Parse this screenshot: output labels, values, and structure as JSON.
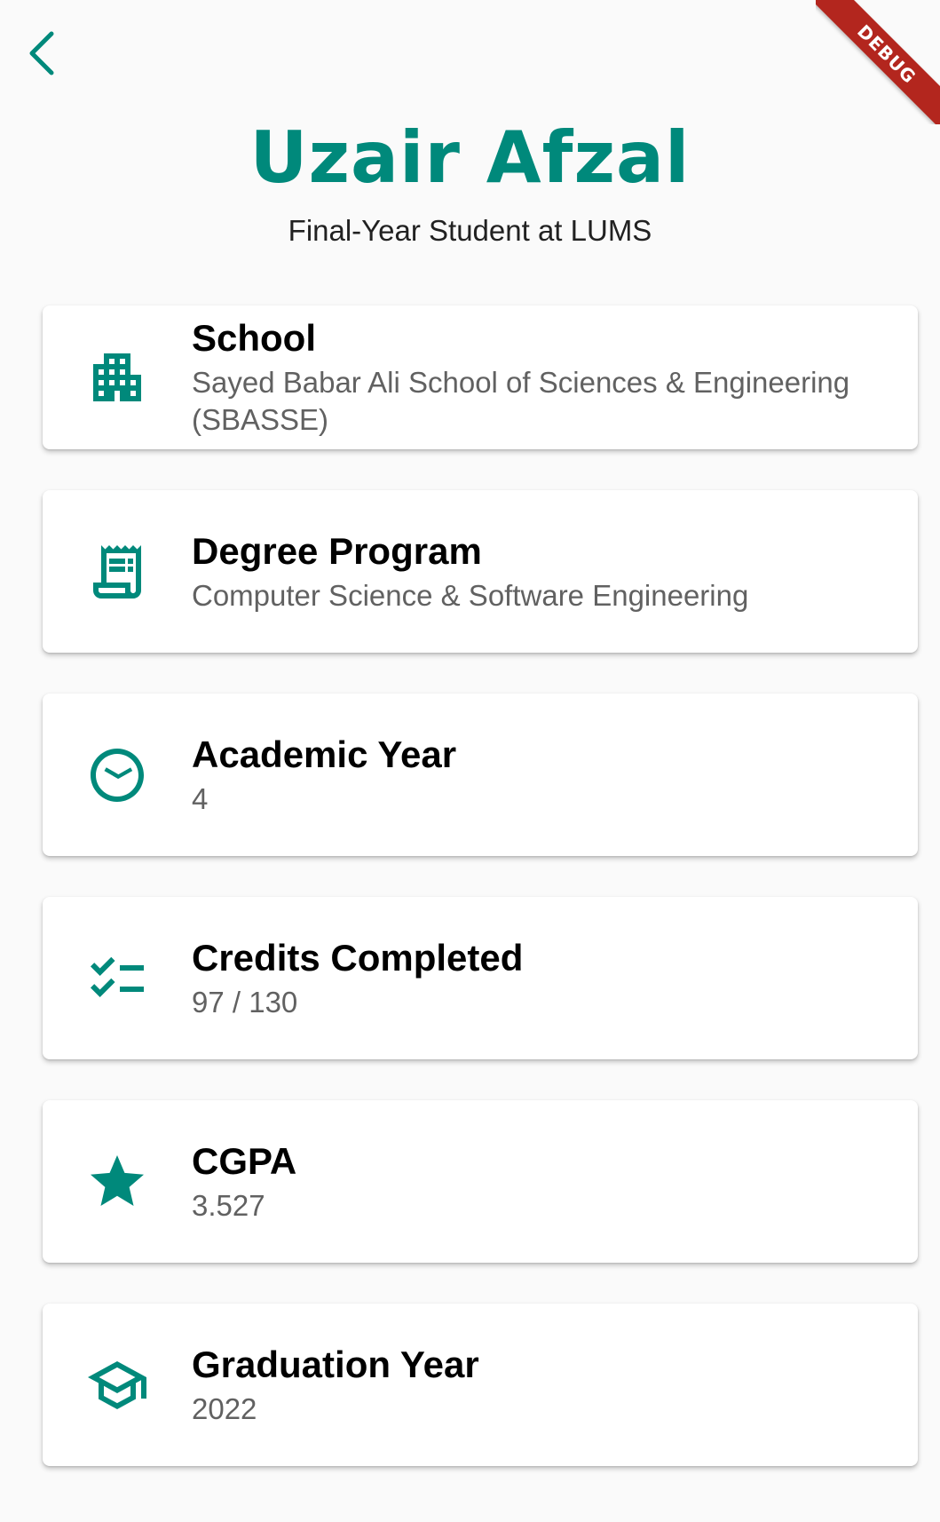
{
  "appbar": {
    "back_icon": "arrow-back-ios-icon",
    "accent_color": "#00897b"
  },
  "debug_banner": {
    "label": "DEBUG",
    "color": "#b3261e"
  },
  "profile": {
    "name": "Uzair Afzal",
    "subtitle": "Final-Year Student at LUMS"
  },
  "cards": [
    {
      "icon": "apartment-icon",
      "title": "School",
      "value": "Sayed Babar Ali School of Sciences & Engineering (SBASSE)"
    },
    {
      "icon": "receipt-long-icon",
      "title": "Degree Program",
      "value": "Computer Science & Software Engineering"
    },
    {
      "icon": "clock-icon",
      "title": "Academic Year",
      "value": "4"
    },
    {
      "icon": "checklist-icon",
      "title": "Credits Completed",
      "value": "97 / 130"
    },
    {
      "icon": "star-icon",
      "title": "CGPA",
      "value": "3.527"
    },
    {
      "icon": "graduation-cap-icon",
      "title": "Graduation Year",
      "value": "2022"
    }
  ]
}
